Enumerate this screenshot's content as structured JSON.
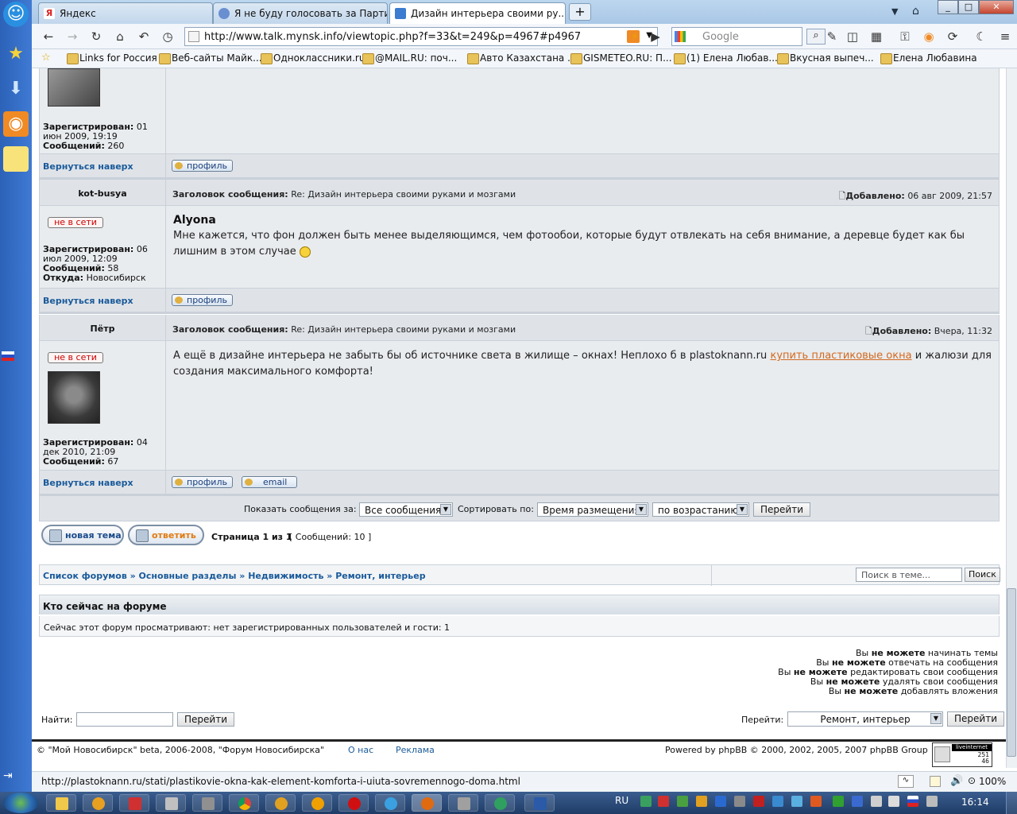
{
  "browser": {
    "tabs": [
      {
        "title": "Яндекс",
        "color": "#d22"
      },
      {
        "title": "Я не буду голосовать за Партию...",
        "color": "#6a8fd0"
      },
      {
        "title": "Дизайн интерьера своими ру...",
        "color": "#3b7bd0"
      }
    ],
    "url": "http://www.talk.mynsk.info/viewtopic.php?f=33&t=249&p=4967#p4967",
    "search_placeholder": "Google",
    "bookmarks": [
      "Links for Россия",
      "Веб-сайты Майк...",
      "Одноклассники.ru",
      "@MAIL.RU: поч...",
      "Авто Казахстана ...",
      "GISMETEO.RU: П...",
      "(1) Елена Любав...",
      "Вкусная выпеч...",
      "Елена Любавина"
    ],
    "status_url": "http://plastoknann.ru/stati/plastikovie-okna-kak-element-komforta-i-uiuta-sovremennogo-doma.html",
    "zoom": "100%"
  },
  "posts": [
    {
      "reg_label": "Зарегистрирован:",
      "reg": "01 июн 2009, 19:19",
      "msgs_label": "Сообщений:",
      "msgs": "260"
    },
    {
      "author": "kot-busya",
      "subject_label": "Заголовок сообщения:",
      "subject": "Re: Дизайн интерьера своими руками и мозгами",
      "added_label": "Добавлено:",
      "added": "06 авг 2009, 21:57",
      "status": "не в сети",
      "quote_author": "Alyona",
      "text": "Мне кажется, что фон должен быть менее выделяющимся, чем фотообои, которые будут отвлекать на себя внимание, а деревце будет как бы лишним в этом случае",
      "reg_label": "Зарегистрирован:",
      "reg": "06 июл 2009, 12:09",
      "msgs_label": "Сообщений:",
      "msgs": "58",
      "from_label": "Откуда:",
      "from": "Новосибирск"
    },
    {
      "author": "Пётр",
      "subject_label": "Заголовок сообщения:",
      "subject": "Re: Дизайн интерьера своими руками и мозгами",
      "added_label": "Добавлено:",
      "added": "Вчера, 11:32",
      "status": "не в сети",
      "text_before": "А ещё в дизайне интерьера не забыть бы об источнике света в жилище – окнах! Неплохо б в plastoknann.ru ",
      "link_text": "купить пластиковые окна",
      "text_after": " и жалюзи для создания максимального комфорта!",
      "reg_label": "Зарегистрирован:",
      "reg": "04 дек 2010, 21:09",
      "msgs_label": "Сообщений:",
      "msgs": "67"
    }
  ],
  "labels": {
    "back_to_top": "Вернуться наверх",
    "profile": "профиль",
    "email": "email",
    "show_messages": "Показать сообщения за:",
    "all_messages": "Все сообщения",
    "sort_by": "Сортировать по:",
    "sort_time": "Время размещения",
    "sort_dir": "по возрастанию",
    "go": "Перейти",
    "new_topic": "новая тема",
    "reply": "ответить",
    "page_info": "Страница 1 из 1",
    "msg_count": "[ Сообщений: 10 ]",
    "search_topic": "Поиск в теме...",
    "search_btn": "Поиск",
    "who_online_title": "Кто сейчас на форуме",
    "who_online_text": "Сейчас этот форум просматривают: нет зарегистрированных пользователей и гости: 1",
    "find": "Найти:",
    "jump_to": "Перейти:",
    "jump_forum": "Ремонт, интерьер",
    "powered": "Powered by phpBB © 2000, 2002, 2005, 2007 phpBB Group",
    "copyright": "© \"Мой Новосибирск\" beta, 2006-2008, \"Форум Новосибирска\"",
    "about": "О нас",
    "ads": "Реклама",
    "liveinternet": "liveinternet",
    "li_count1": "251",
    "li_count2": "46"
  },
  "breadcrumb": [
    "Список форумов",
    "Основные разделы",
    "Недвижимость",
    "Ремонт, интерьер"
  ],
  "permissions": [
    {
      "pre": "Вы ",
      "b": "не можете",
      "post": " начинать темы"
    },
    {
      "pre": "Вы ",
      "b": "не можете",
      "post": " отвечать на сообщения"
    },
    {
      "pre": "Вы ",
      "b": "не можете",
      "post": " редактировать свои сообщения"
    },
    {
      "pre": "Вы ",
      "b": "не можете",
      "post": " удалять свои сообщения"
    },
    {
      "pre": "Вы ",
      "b": "не можете",
      "post": " добавлять вложения"
    }
  ],
  "taskbar": {
    "lang": "RU",
    "time": "16:14"
  }
}
